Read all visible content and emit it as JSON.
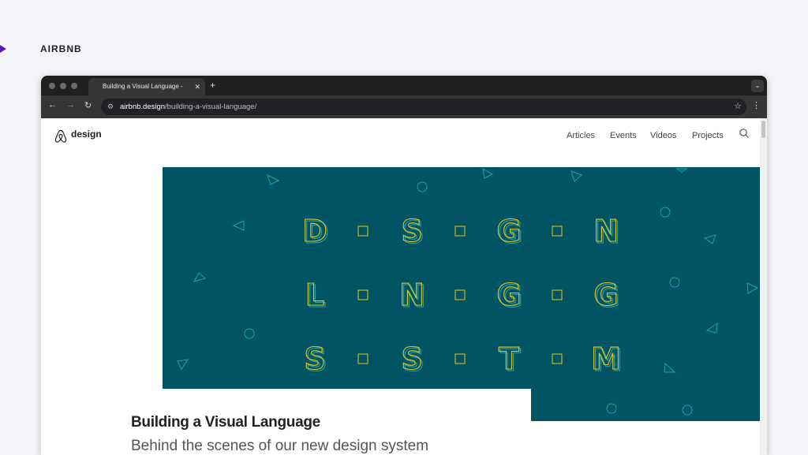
{
  "slide_brand": "AIRBNB",
  "browser": {
    "tab_title": "Building a Visual Language -",
    "new_tab_symbol": "+",
    "url_host": "airbnb.design",
    "url_path": "/building-a-visual-language/"
  },
  "site": {
    "logo_text": "design",
    "nav": [
      "Articles",
      "Events",
      "Videos",
      "Projects"
    ]
  },
  "hero": {
    "background_color": "#005463",
    "letter_rows": [
      [
        "D",
        "S",
        "G",
        "N"
      ],
      [
        "L",
        "N",
        "G",
        "G"
      ],
      [
        "S",
        "S",
        "T",
        "M"
      ]
    ]
  },
  "article": {
    "title": "Building a Visual Language",
    "subtitle": "Behind the scenes of our new design system"
  }
}
